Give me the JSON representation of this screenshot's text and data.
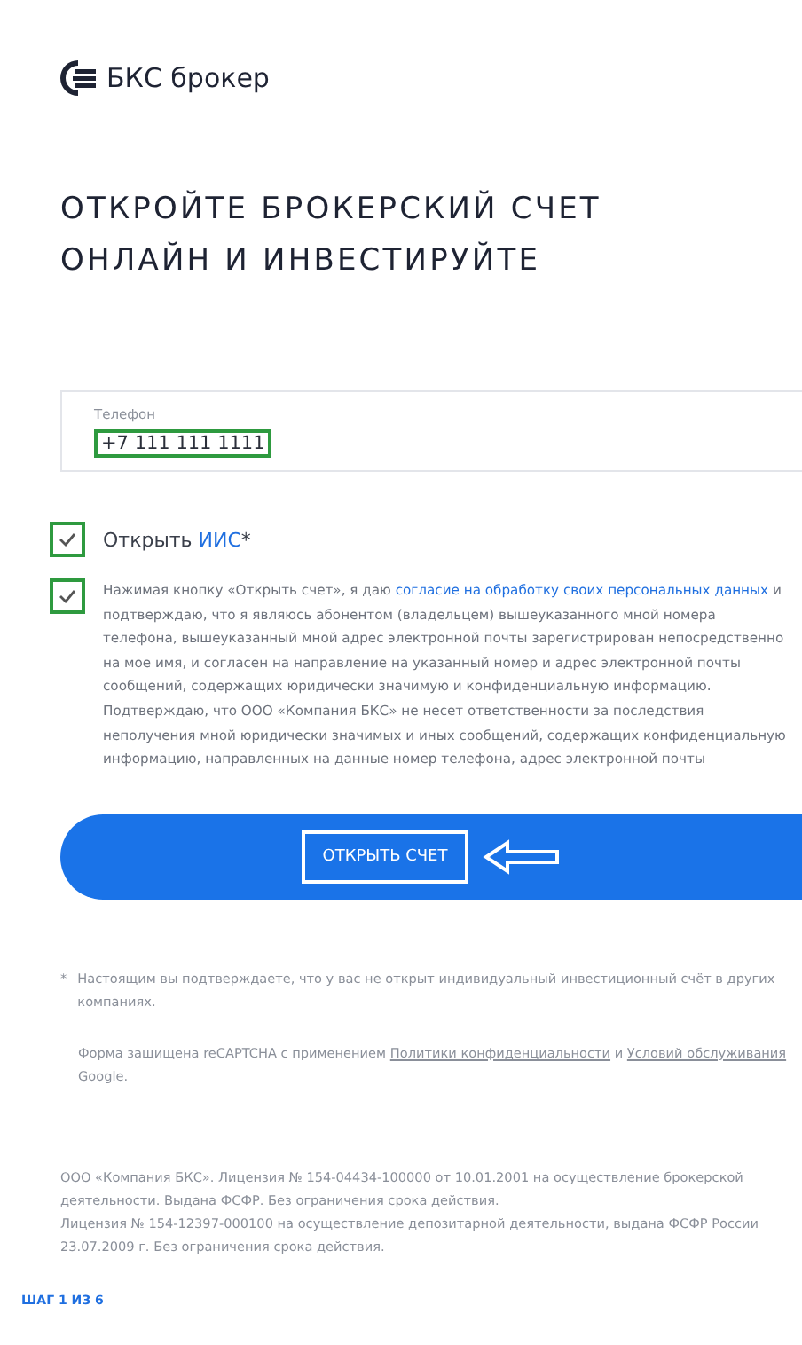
{
  "logo": {
    "text": "БКС брокер"
  },
  "heading": "ОТКРОЙТЕ БРОКЕРСКИЙ СЧЕТ ОНЛАЙН И ИНВЕСТИРУЙТЕ",
  "phone_field": {
    "label": "Телефон",
    "value": "+7 111 111 1111",
    "highlighted": true
  },
  "iis_checkbox": {
    "checked": true,
    "highlighted": true,
    "label_before": "Открыть",
    "link": "ИИС",
    "label_after": "*"
  },
  "consent_checkbox": {
    "checked": true,
    "highlighted": true,
    "text_before": "Нажимая кнопку «Открыть счет», я даю",
    "link": "согласие на обработку своих персональных данных",
    "text_after": "и подтверждаю, что я являюсь абонентом (владельцем) вышеуказанного мной номера телефона, вышеуказанный мной адрес электронной почты зарегистрирован непосредственно на мое имя, и согласен на направление на указанный номер и адрес электронной почты сообщений, содержащих юридически значимую и конфиденциальную информацию. Подтверждаю, что ООО «Компания БКС» не несет ответственности за последствия неполучения мной юридически значимых и иных сообщений, содержащих конфиденциальную информацию, направленных на данные номер телефона, адрес электронной почты"
  },
  "submit_button": {
    "label": "ОТКРЫТЬ СЧЕТ",
    "highlighted": true,
    "arrow": true
  },
  "footnote": {
    "mark": "*",
    "text": "Настоящим вы подтверждаете, что у вас не открыт индивидуальный инвестиционный счёт в других компаниях."
  },
  "recaptcha": {
    "text_before": "Форма защищена reCAPTCHA с применением",
    "link_1": "Политики конфиденциальности",
    "text_middle": "и",
    "link_2": "Условий обслуживания",
    "text_after": "Google."
  },
  "license": [
    "ООО «Компания БКС». Лицензия № 154-04434-100000 от 10.01.2001 на осуществление брокерской деятельности. Выдана ФСФР. Без ограничения срока действия.",
    "Лицензия № 154-12397-000100 на осуществление депозитарной деятельности, выдана ФСФР России 23.07.2009 г. Без ограничения срока действия."
  ],
  "step": "ШАГ 1 ИЗ 6"
}
